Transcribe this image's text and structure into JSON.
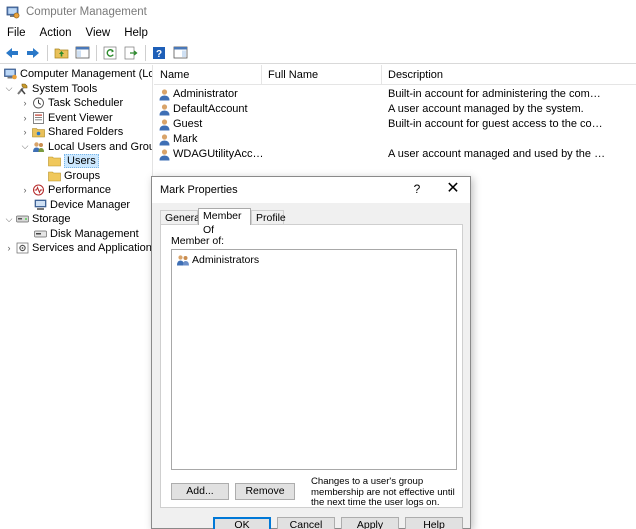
{
  "window": {
    "title": "Computer Management",
    "menu": [
      "File",
      "Action",
      "View",
      "Help"
    ]
  },
  "tree": {
    "items": [
      {
        "label": "Computer Management (Local",
        "icon": "computer-management-icon",
        "chevron": "",
        "indent": 0
      },
      {
        "label": "System Tools",
        "icon": "system-tools-icon",
        "chevron": "expanded",
        "indent": 1
      },
      {
        "label": "Task Scheduler",
        "icon": "task-scheduler-icon",
        "chevron": "collapsed",
        "indent": 2
      },
      {
        "label": "Event Viewer",
        "icon": "event-viewer-icon",
        "chevron": "collapsed",
        "indent": 2
      },
      {
        "label": "Shared Folders",
        "icon": "shared-folders-icon",
        "chevron": "collapsed",
        "indent": 2
      },
      {
        "label": "Local Users and Groups",
        "icon": "local-users-groups-icon",
        "chevron": "expanded",
        "indent": 2
      },
      {
        "label": "Users",
        "icon": "folder-icon",
        "chevron": "",
        "indent": 3,
        "selected": true
      },
      {
        "label": "Groups",
        "icon": "folder-icon",
        "chevron": "",
        "indent": 3
      },
      {
        "label": "Performance",
        "icon": "performance-icon",
        "chevron": "collapsed",
        "indent": 2
      },
      {
        "label": "Device Manager",
        "icon": "device-manager-icon",
        "chevron": "",
        "indent": 2
      },
      {
        "label": "Storage",
        "icon": "storage-icon",
        "chevron": "expanded",
        "indent": 1
      },
      {
        "label": "Disk Management",
        "icon": "disk-management-icon",
        "chevron": "",
        "indent": 2
      },
      {
        "label": "Services and Applications",
        "icon": "services-applications-icon",
        "chevron": "collapsed",
        "indent": 1
      }
    ]
  },
  "list": {
    "columns": [
      "Name",
      "Full Name",
      "Description"
    ],
    "rows": [
      {
        "name": "Administrator",
        "full_name": "",
        "description": "Built-in account for administering the computer/..."
      },
      {
        "name": "DefaultAccount",
        "full_name": "",
        "description": "A user account managed by the system."
      },
      {
        "name": "Guest",
        "full_name": "",
        "description": "Built-in account for guest access to the computer..."
      },
      {
        "name": "Mark",
        "full_name": "",
        "description": ""
      },
      {
        "name": "WDAGUtilityAccount",
        "full_name": "",
        "description": "A user account managed and used by the system ..."
      }
    ]
  },
  "dialog": {
    "title": "Mark Properties",
    "help": "?",
    "close": "✕",
    "tabs": [
      "General",
      "Member Of",
      "Profile"
    ],
    "active_tab": "Member Of",
    "member_of_label": "Member of:",
    "members": [
      "Administrators"
    ],
    "add_label": "Add...",
    "remove_label": "Remove",
    "note": "Changes to a user's group membership are not effective until the next time the user logs on.",
    "ok_label": "OK",
    "cancel_label": "Cancel",
    "apply_label": "Apply",
    "help_label": "Help"
  },
  "colors": {
    "selection": "#cce8ff",
    "accent": "#0078d7",
    "dialog_bg": "#f0f0f0"
  }
}
